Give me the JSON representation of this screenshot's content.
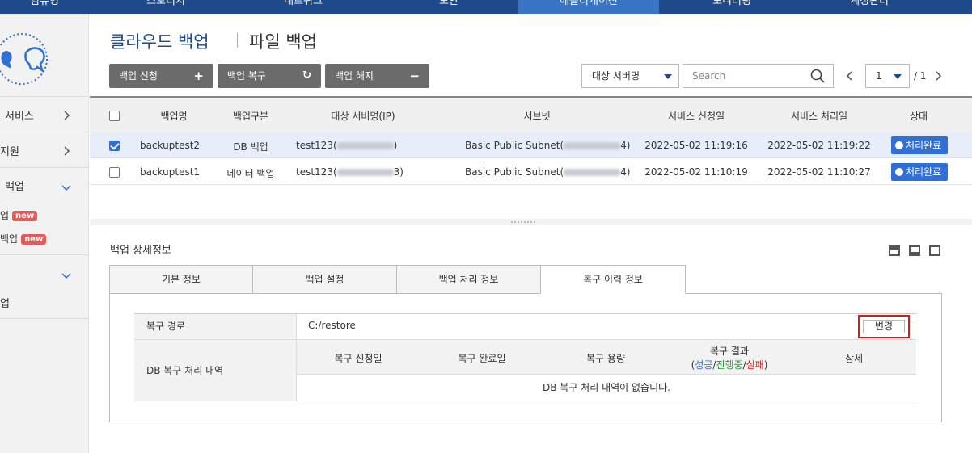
{
  "nav": {
    "items": [
      {
        "label": "임유형"
      },
      {
        "label": "스토리지"
      },
      {
        "label": "네트워크"
      },
      {
        "label": "보안"
      },
      {
        "label": "애플리케이션"
      },
      {
        "label": "모니터링"
      },
      {
        "label": "계정관리"
      }
    ]
  },
  "sidebar": {
    "items": [
      {
        "label": "서비스"
      },
      {
        "label": "지원"
      },
      {
        "label": "백업"
      },
      {
        "label": "업"
      },
      {
        "label": "백업"
      },
      {
        "label": ""
      },
      {
        "label": "업"
      }
    ],
    "badge": "new"
  },
  "page": {
    "title_primary": "클라우드 백업",
    "title_secondary": "파일 백업"
  },
  "toolbar": {
    "apply_label": "백업 신청",
    "restore_label": "백업 복구",
    "cancel_label": "백업 해지",
    "server_select": "대상 서버명",
    "search_placeholder": "Search",
    "page_current": "1",
    "page_total": "/ 1"
  },
  "table": {
    "columns": [
      "백업명",
      "백업구분",
      "대상 서버명(IP)",
      "서브넷",
      "서비스 신청일",
      "서비스 처리일",
      "상태"
    ],
    "rows": [
      {
        "name": "backuptest2",
        "type": "DB 백업",
        "server": "test123(",
        "server_end": ")",
        "subnet": "Basic Public Subnet(",
        "subnet_end": "4)",
        "applied": "2022-05-02 11:19:16",
        "processed": "2022-05-02 11:19:22",
        "status": "처리완료",
        "checked": true
      },
      {
        "name": "backuptest1",
        "type": "데이터 백업",
        "server": "test123(",
        "server_end": "3)",
        "subnet": "Basic Public Subnet(",
        "subnet_end": "4)",
        "applied": "2022-05-02 11:10:19",
        "processed": "2022-05-02 11:10:27",
        "status": "처리완료",
        "checked": false
      }
    ]
  },
  "detail": {
    "title": "백업 상세정보",
    "tabs": [
      {
        "label": "기본 정보"
      },
      {
        "label": "백업 설정"
      },
      {
        "label": "백업 처리 정보"
      },
      {
        "label": "복구 이력 정보"
      }
    ],
    "restore_path_label": "복구 경로",
    "restore_path_value": "C:/restore",
    "change_button": "변경",
    "db_history_label": "DB 복구 처리 내역",
    "history_columns": {
      "applied": "복구 신청일",
      "completed": "복구 완료일",
      "size": "복구 용량",
      "result": "복구 결과",
      "result_ok": "성공",
      "result_progress": "진행중",
      "result_fail": "실패",
      "detail": "상세"
    },
    "empty_message": "DB 복구 처리 내역이 없습니다."
  },
  "colors": {
    "nav_bg": "#1e4a8c",
    "nav_active": "#3a75c4",
    "status_blue": "#2f6fd6",
    "highlight_red": "#d11d1d",
    "success": "#2f6fd6",
    "progress": "#1f9a2f",
    "fail": "#d11d1d"
  }
}
